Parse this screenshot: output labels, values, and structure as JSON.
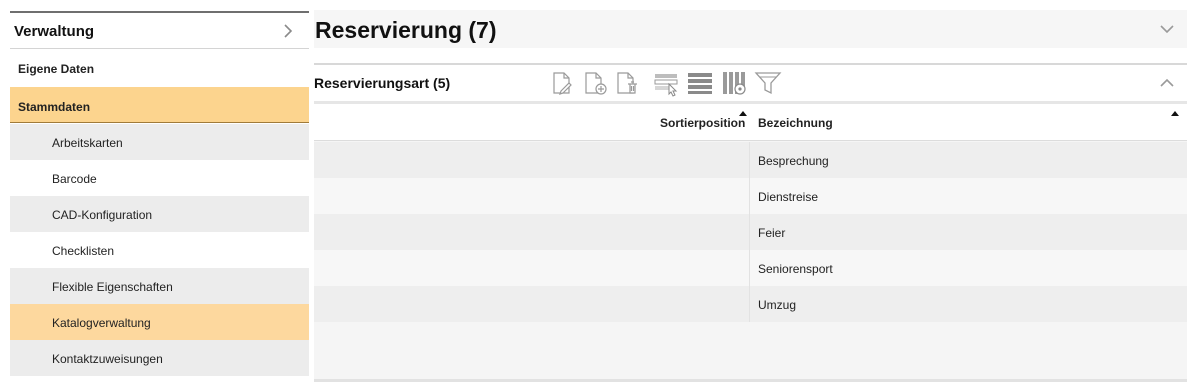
{
  "sidebar": {
    "title": "Verwaltung",
    "toggle_icon": "chevron-right-icon",
    "sections": [
      {
        "label": "Eigene Daten"
      },
      {
        "label": "Stammdaten"
      }
    ],
    "items": [
      {
        "label": "Arbeitskarten"
      },
      {
        "label": "Barcode"
      },
      {
        "label": "CAD-Konfiguration"
      },
      {
        "label": "Checklisten"
      },
      {
        "label": "Flexible Eigenschaften"
      },
      {
        "label": "Katalogverwaltung"
      },
      {
        "label": "Kontaktzuweisungen"
      }
    ],
    "active_section": "Stammdaten",
    "selected_item": "Katalogverwaltung"
  },
  "main": {
    "title": "Reservierung (7)",
    "collapse_icon": "chevron-down-icon",
    "panel": {
      "title": "Reservierungsart (5)",
      "collapse_icon": "chevron-up-icon",
      "toolbar": [
        {
          "icon": "edit-document-icon"
        },
        {
          "icon": "add-document-icon"
        },
        {
          "icon": "delete-document-icon"
        },
        {
          "icon": "select-rows-icon"
        },
        {
          "icon": "list-view-icon"
        },
        {
          "icon": "column-settings-icon"
        },
        {
          "icon": "filter-icon"
        }
      ],
      "columns": [
        "Sortierposition",
        "Bezeichnung"
      ],
      "rows": [
        {
          "sortierposition": "",
          "bezeichnung": "Besprechung"
        },
        {
          "sortierposition": "",
          "bezeichnung": "Dienstreise"
        },
        {
          "sortierposition": "",
          "bezeichnung": "Feier"
        },
        {
          "sortierposition": "",
          "bezeichnung": "Seniorensport"
        },
        {
          "sortierposition": "",
          "bezeichnung": "Umzug"
        }
      ]
    }
  },
  "colors": {
    "active_orange": "#fcd48e",
    "row_grey": "#ececec",
    "divider": "#6f6f6f"
  }
}
